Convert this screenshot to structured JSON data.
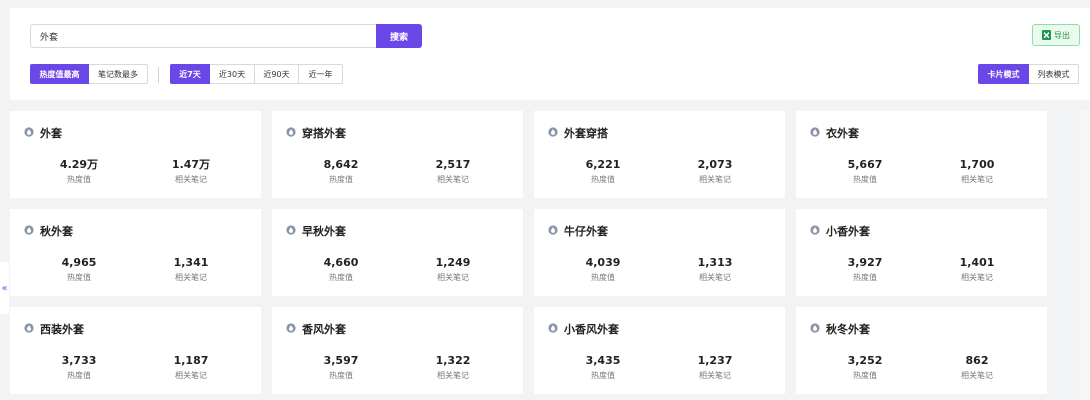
{
  "search": {
    "value": "外套",
    "button_label": "搜索"
  },
  "export_label": "导出",
  "sort_tabs": [
    {
      "label": "热度值最高",
      "active": true
    },
    {
      "label": "笔记数最多",
      "active": false
    }
  ],
  "range_tabs": [
    {
      "label": "近7天",
      "active": true
    },
    {
      "label": "近30天",
      "active": false
    },
    {
      "label": "近90天",
      "active": false
    },
    {
      "label": "近一年",
      "active": false
    }
  ],
  "view_tabs": [
    {
      "label": "卡片模式",
      "active": true
    },
    {
      "label": "列表模式",
      "active": false
    }
  ],
  "stat_labels": {
    "heat": "热度值",
    "notes": "相关笔记"
  },
  "cards": [
    {
      "title": "外套",
      "heat": "4.29万",
      "notes": "1.47万"
    },
    {
      "title": "穿搭外套",
      "heat": "8,642",
      "notes": "2,517"
    },
    {
      "title": "外套穿搭",
      "heat": "6,221",
      "notes": "2,073"
    },
    {
      "title": "衣外套",
      "heat": "5,667",
      "notes": "1,700"
    },
    {
      "title": "秋外套",
      "heat": "4,965",
      "notes": "1,341"
    },
    {
      "title": "早秋外套",
      "heat": "4,660",
      "notes": "1,249"
    },
    {
      "title": "牛仔外套",
      "heat": "4,039",
      "notes": "1,313"
    },
    {
      "title": "小香外套",
      "heat": "3,927",
      "notes": "1,401"
    },
    {
      "title": "西装外套",
      "heat": "3,733",
      "notes": "1,187"
    },
    {
      "title": "香风外套",
      "heat": "3,597",
      "notes": "1,322"
    },
    {
      "title": "小香风外套",
      "heat": "3,435",
      "notes": "1,237"
    },
    {
      "title": "秋冬外套",
      "heat": "3,252",
      "notes": "862"
    }
  ],
  "sidebar_toggle": "«",
  "colors": {
    "accent": "#6c47e8",
    "export_green": "#1f9b4e",
    "drop_icon": "#8a94a6"
  }
}
